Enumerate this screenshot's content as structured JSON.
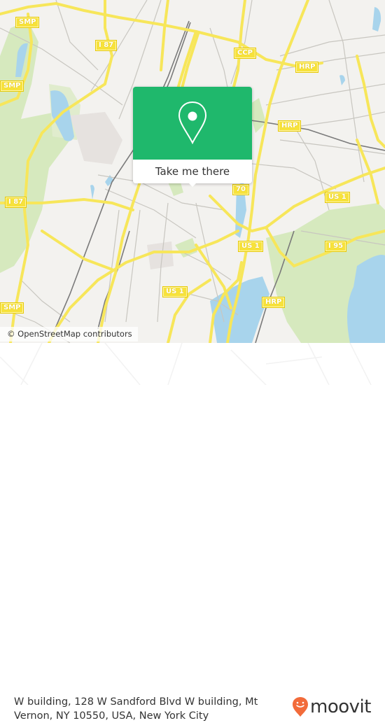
{
  "map": {
    "road_labels": [
      {
        "id": "smp-1",
        "text": "SMP"
      },
      {
        "id": "smp-2",
        "text": "SMP"
      },
      {
        "id": "smp-3",
        "text": "SMP"
      },
      {
        "id": "i87-1",
        "text": "I 87"
      },
      {
        "id": "i87-2",
        "text": "I 87"
      },
      {
        "id": "ccp",
        "text": "CCP"
      },
      {
        "id": "hrp-1",
        "text": "HRP"
      },
      {
        "id": "hrp-2",
        "text": "HRP"
      },
      {
        "id": "hrp-3",
        "text": "HRP"
      },
      {
        "id": "route-70",
        "text": "70"
      },
      {
        "id": "us1-1",
        "text": "US 1"
      },
      {
        "id": "us1-2",
        "text": "US 1"
      },
      {
        "id": "us1-3",
        "text": "US 1"
      },
      {
        "id": "i95",
        "text": "I 95"
      }
    ],
    "attribution": "© OpenStreetMap contributors",
    "colors": {
      "land": "#f3f2ef",
      "park": "#cfe6b0",
      "water": "#a8d4ec",
      "major_road": "#f7e65a",
      "minor_road": "#c8c6c0",
      "rail": "#777777"
    }
  },
  "popup": {
    "pin_icon": "map-pin-icon",
    "button_label": "Take me there",
    "accent_color": "#1fb86c"
  },
  "footer": {
    "address": "W building, 128 W Sandford Blvd W building, Mt Vernon, NY 10550, USA, New York City",
    "brand_name": "moovit",
    "brand_color": "#f26b3a"
  }
}
